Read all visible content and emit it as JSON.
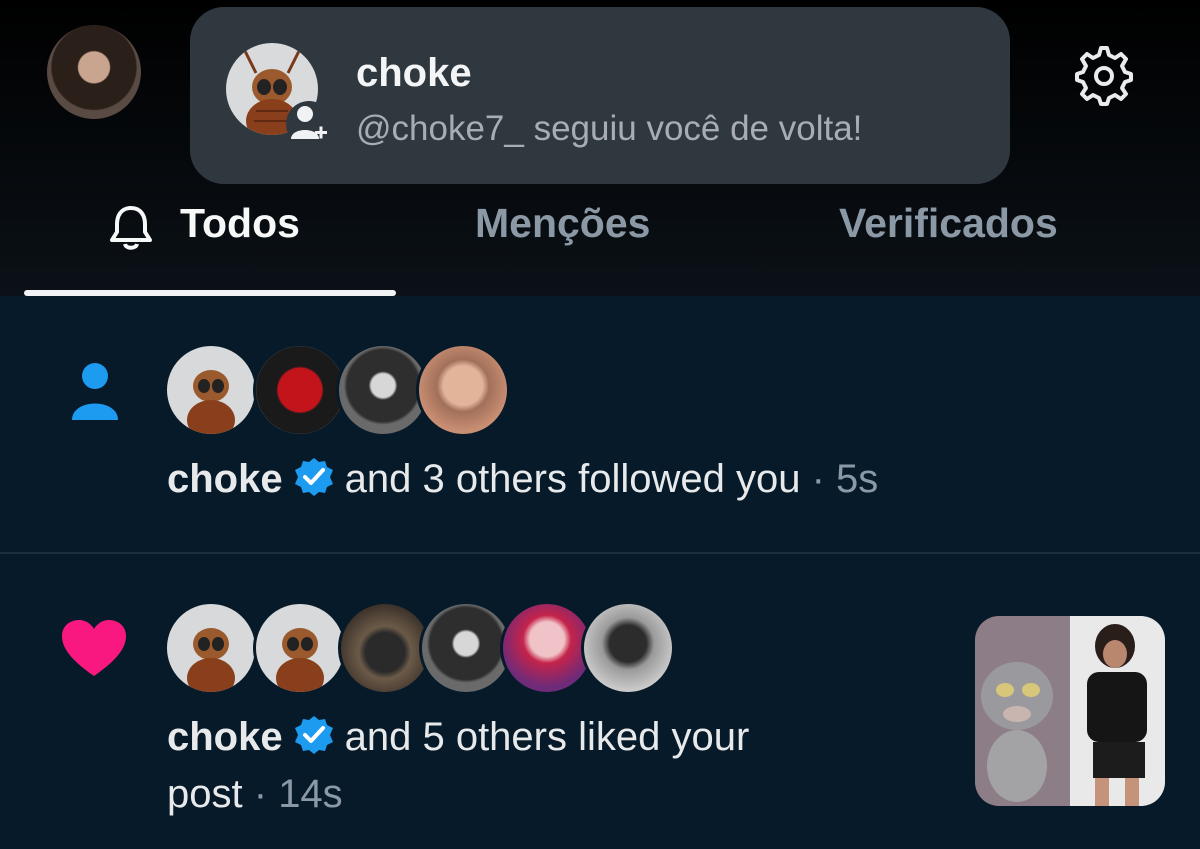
{
  "header": {
    "toast": {
      "name": "choke",
      "message": "@choke7_ seguiu você de volta!"
    },
    "tabs": [
      {
        "label": "Todos",
        "active": true
      },
      {
        "label": "Menções",
        "active": false
      },
      {
        "label": "Verificados",
        "active": false
      }
    ],
    "icons": [
      "profile-avatar",
      "person-add-icon",
      "gear-icon",
      "bell-icon"
    ]
  },
  "notifications": [
    {
      "type": "follow",
      "icon": "person-icon",
      "name": "choke",
      "text": "and 3 others followed you",
      "separator": "·",
      "time": "5s",
      "avatar_count": 4
    },
    {
      "type": "like",
      "icon": "heart-icon",
      "name": "choke",
      "text_line1": "and 5 others liked your",
      "text_line2": "post",
      "separator": "·",
      "time": "14s",
      "avatar_count": 6
    }
  ],
  "colors": {
    "background": "#071a29",
    "accent_blue": "#1d9bf0",
    "heart_pink": "#f91880",
    "toast_bg": "#30383f",
    "muted_text": "#8b98a5"
  }
}
